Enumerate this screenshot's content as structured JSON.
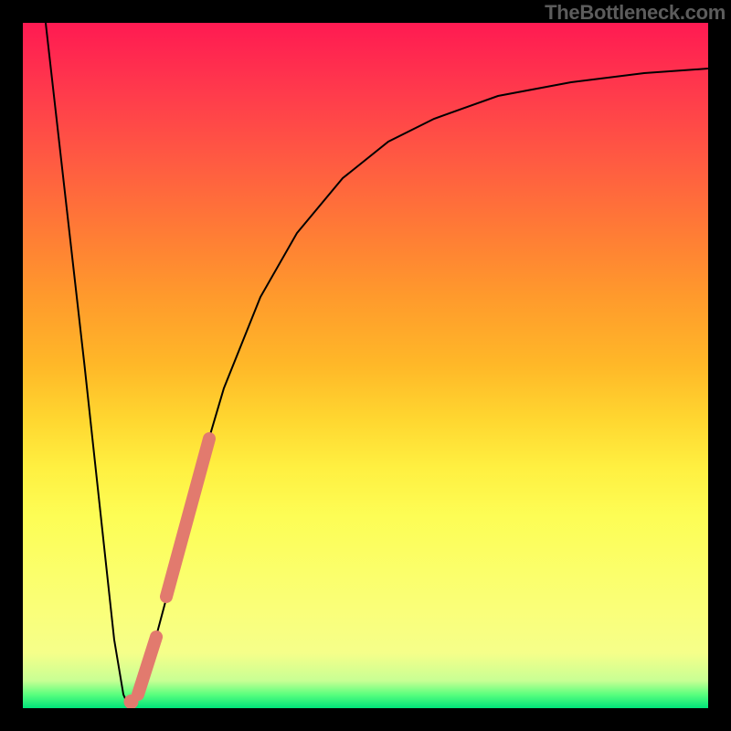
{
  "watermark": "TheBottleneck.com",
  "chart_data": {
    "type": "line",
    "title": "",
    "xlabel": "",
    "ylabel": "",
    "xlim": [
      0,
      1
    ],
    "ylim": [
      0,
      1
    ],
    "series": [
      {
        "name": "bottleneck-curve",
        "color": "#000000",
        "stroke_width": 2,
        "points": [
          {
            "x": 0.0333,
            "y": 1.0
          },
          {
            "x": 0.09,
            "y": 0.5
          },
          {
            "x": 0.1333,
            "y": 0.1
          },
          {
            "x": 0.1467,
            "y": 0.02
          },
          {
            "x": 0.1533,
            "y": 0.005
          },
          {
            "x": 0.16,
            "y": 0.005
          },
          {
            "x": 0.1733,
            "y": 0.03
          },
          {
            "x": 0.1933,
            "y": 0.1
          },
          {
            "x": 0.22,
            "y": 0.2
          },
          {
            "x": 0.25,
            "y": 0.32
          },
          {
            "x": 0.2933,
            "y": 0.4667
          },
          {
            "x": 0.3467,
            "y": 0.6
          },
          {
            "x": 0.4,
            "y": 0.6933
          },
          {
            "x": 0.4667,
            "y": 0.7733
          },
          {
            "x": 0.5333,
            "y": 0.8267
          },
          {
            "x": 0.6,
            "y": 0.86
          },
          {
            "x": 0.6933,
            "y": 0.8933
          },
          {
            "x": 0.8,
            "y": 0.9133
          },
          {
            "x": 0.9067,
            "y": 0.9267
          },
          {
            "x": 1.0,
            "y": 0.9333
          }
        ]
      },
      {
        "name": "highlight-segment-upper",
        "color": "#e27a6e",
        "stroke_width": 14,
        "linecap": "round",
        "points": [
          {
            "x": 0.2093,
            "y": 0.1627
          },
          {
            "x": 0.272,
            "y": 0.3933
          }
        ]
      },
      {
        "name": "highlight-blob-lower",
        "color": "#e27a6e",
        "stroke_width": 14,
        "linecap": "round",
        "points": [
          {
            "x": 0.168,
            "y": 0.02
          },
          {
            "x": 0.1947,
            "y": 0.104
          }
        ]
      },
      {
        "name": "highlight-dot-min",
        "color": "#e27a6e",
        "marker": "circle",
        "marker_radius": 8,
        "points": [
          {
            "x": 0.158,
            "y": 0.0093
          }
        ]
      }
    ]
  }
}
